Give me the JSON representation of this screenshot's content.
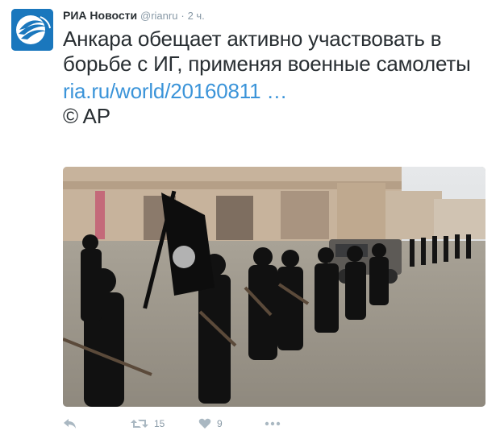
{
  "tweet": {
    "author": {
      "fullname": "РИА Новости",
      "username": "@rianru",
      "separator": "·",
      "time": "2 ч."
    },
    "text": "Анкара обещает активно участвовать в борьбе с ИГ, применяя военные самолеты",
    "link": "ria.ru/world/20160811 …",
    "credit": "© AP",
    "media": {
      "icon": "photo-scene",
      "description_visible": ""
    },
    "actions": {
      "reply_icon": "reply-icon",
      "retweet_icon": "retweet-icon",
      "retweet_count": "15",
      "like_icon": "heart-icon",
      "like_count": "9",
      "more_icon": "more-icon"
    }
  },
  "colors": {
    "link": "#3b94d9",
    "muted": "#8899a6",
    "icon": "#aab8c2",
    "avatar_bg": "#1a77bd"
  }
}
